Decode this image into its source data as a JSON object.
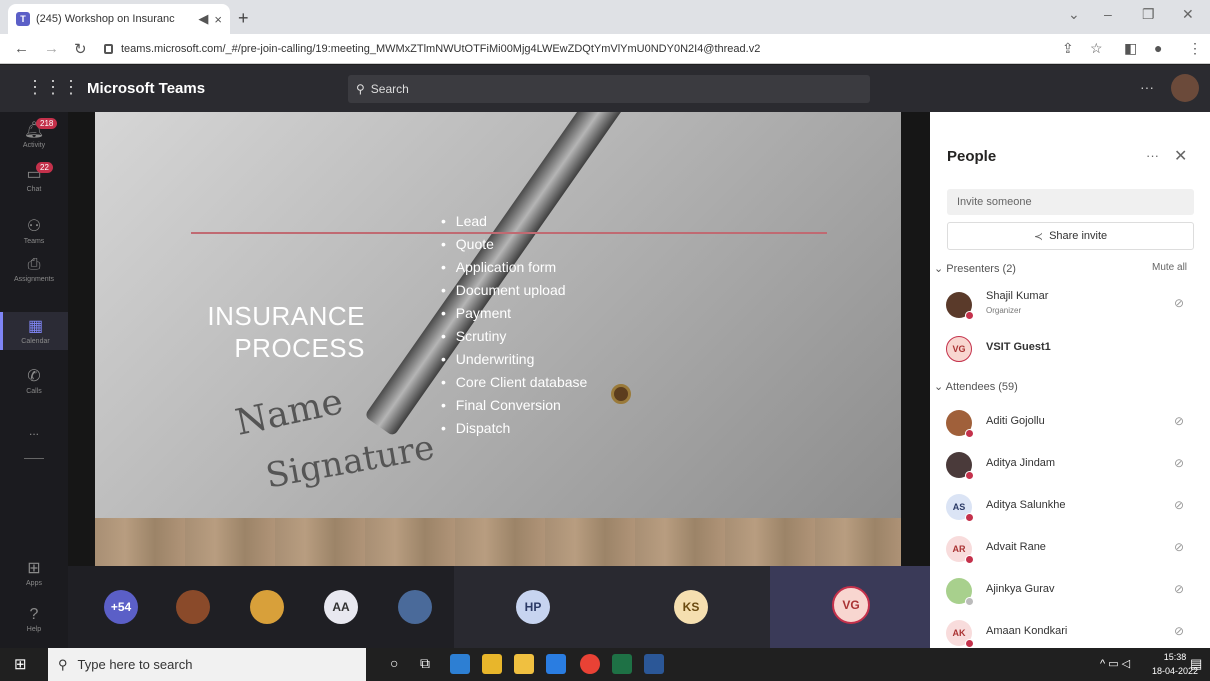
{
  "browser": {
    "tab_title": "(245) Workshop on Insuranc",
    "tab_close": "×",
    "new_tab": "+",
    "url": "teams.microsoft.com/_#/pre-join-calling/19:meeting_MWMxZTlmNWUtOTFiMi00Mjg4LWEwZDQtYmVlYmU0NDY0N2I4@thread.v2"
  },
  "teams": {
    "brand": "Microsoft Teams",
    "search_placeholder": "Search",
    "more": "···"
  },
  "rail": [
    {
      "label": "Activity",
      "icon": "bell-icon",
      "badge": "218"
    },
    {
      "label": "Chat",
      "icon": "chat-icon",
      "badge": "22"
    },
    {
      "label": "Teams",
      "icon": "teams-icon",
      "badge": ""
    },
    {
      "label": "Assignments",
      "icon": "assignments-icon",
      "badge": ""
    },
    {
      "label": "Calendar",
      "icon": "calendar-icon",
      "badge": ""
    },
    {
      "label": "Calls",
      "icon": "phone-icon",
      "badge": ""
    },
    {
      "label": "...",
      "icon": "more-icon",
      "badge": ""
    },
    {
      "label": "Apps",
      "icon": "apps-icon",
      "badge": ""
    },
    {
      "label": "Help",
      "icon": "help-icon",
      "badge": ""
    }
  ],
  "slide": {
    "title_line1": "INSURANCE",
    "title_line2": "PROCESS",
    "bullets": [
      "Lead",
      "Quote",
      "Application form",
      "Document upload",
      "Payment",
      "Scrutiny",
      "Underwriting",
      "Core Client database",
      "Final Conversion",
      "Dispatch"
    ],
    "bg_word1": "Name",
    "bg_word2": "Signature"
  },
  "participants_bar": {
    "overflow": "+54",
    "tiles": [
      "AA",
      "HP",
      "KS",
      "VG"
    ]
  },
  "people": {
    "title": "People",
    "invite_placeholder": "Invite someone",
    "share_invite": "Share invite",
    "presenters_label": "Presenters (2)",
    "mute_all": "Mute all",
    "attendees_label": "Attendees (59)",
    "presenters": [
      {
        "name": "Shajil Kumar",
        "role": "Organizer",
        "initials": ""
      },
      {
        "name": "VSIT Guest1",
        "role": "",
        "initials": "VG"
      }
    ],
    "attendees": [
      {
        "name": "Aditi Gojollu",
        "initials": ""
      },
      {
        "name": "Aditya Jindam",
        "initials": ""
      },
      {
        "name": "Aditya Salunkhe",
        "initials": "AS"
      },
      {
        "name": "Advait Rane",
        "initials": "AR"
      },
      {
        "name": "Ajinkya Gurav",
        "initials": ""
      },
      {
        "name": "Amaan Kondkari",
        "initials": "AK"
      }
    ]
  },
  "taskbar": {
    "search_placeholder": "Type here to search",
    "time": "15:38",
    "date": "18-04-2022"
  },
  "colors": {
    "teams_purple": "#5b5fc7",
    "notification_red": "#c4314b",
    "header_dark": "#2b2b30"
  }
}
